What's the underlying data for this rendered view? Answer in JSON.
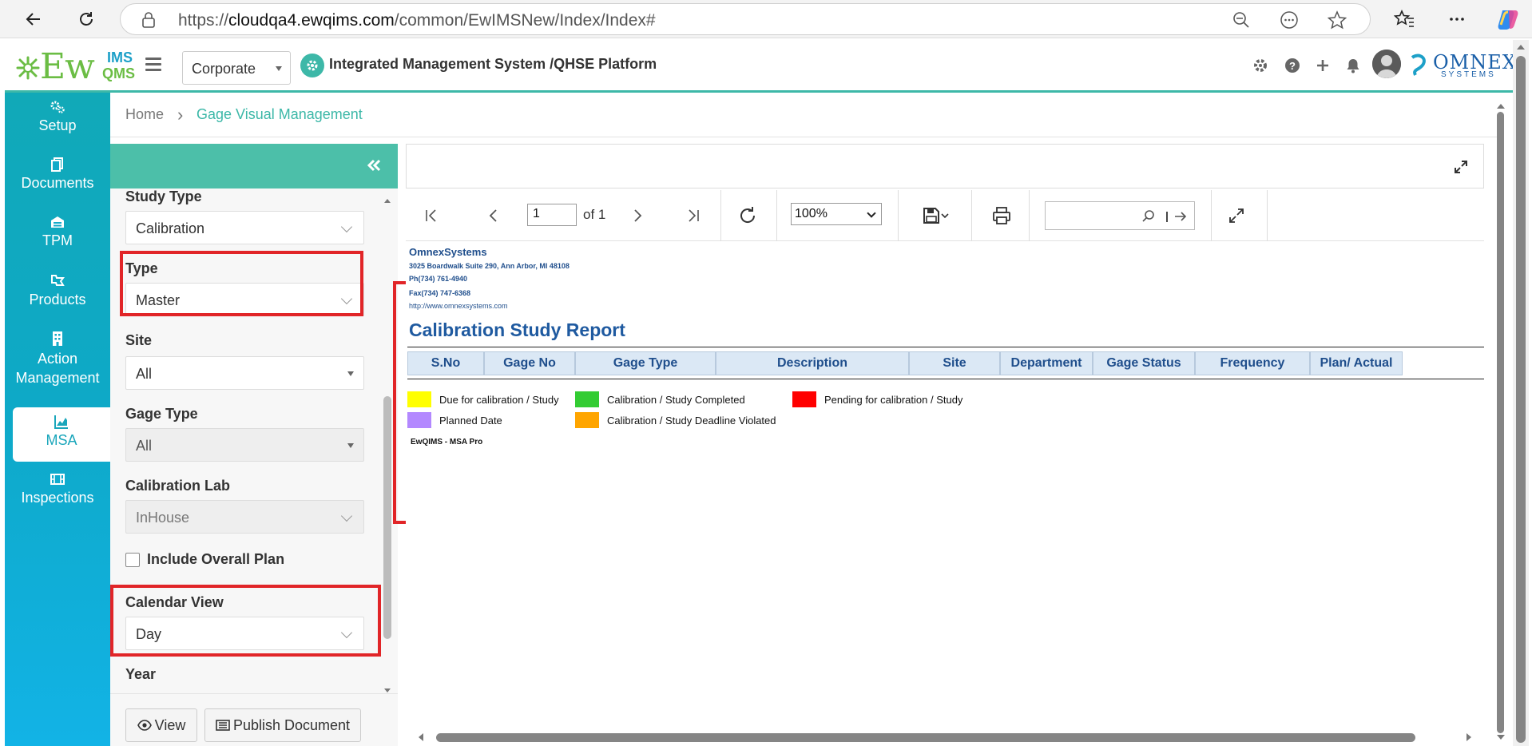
{
  "browser": {
    "url_prefix": "https://",
    "url_host": "cloudqa4.ewqims.com",
    "url_path": "/common/EwIMSNew/Index/Index#",
    "icons": [
      "back-arrow-icon",
      "refresh-icon",
      "lock-icon",
      "zoom-out-icon",
      "more-circle-icon",
      "favorite-star-icon",
      "favorites-list-icon",
      "ellipsis-icon",
      "copilot-icon"
    ]
  },
  "header": {
    "logo_ew": "Ew",
    "logo_ims": "IMS",
    "logo_qms": "QMS",
    "corporate_select": "Corporate",
    "platform_title": "Integrated Management System /QHSE Platform",
    "omnex_top": "OMNEX",
    "omnex_bottom": "SYSTEMS",
    "accent": "#3db8a8"
  },
  "sidebar": {
    "items": [
      {
        "label": "Setup",
        "icon": "gears-icon"
      },
      {
        "label": "Documents",
        "icon": "documents-icon"
      },
      {
        "label": "TPM",
        "icon": "tpm-icon"
      },
      {
        "label": "Products",
        "icon": "products-icon"
      },
      {
        "label": "Action Management",
        "icon": "building-icon"
      },
      {
        "label": "MSA",
        "icon": "chart-icon",
        "active": true
      },
      {
        "label": "Inspections",
        "icon": "film-icon"
      }
    ]
  },
  "breadcrumb": {
    "home": "Home",
    "separator": "›",
    "current": "Gage Visual Management"
  },
  "filters": {
    "study_type_label": "Study Type",
    "study_type_value": "Calibration",
    "type_label": "Type",
    "type_value": "Master",
    "site_label": "Site",
    "site_value": "All",
    "gage_type_label": "Gage Type",
    "gage_type_value": "All",
    "calibration_lab_label": "Calibration Lab",
    "calibration_lab_value": "InHouse",
    "include_overall_plan_label": "Include Overall Plan",
    "include_overall_plan_checked": false,
    "calendar_view_label": "Calendar View",
    "calendar_view_value": "Day",
    "year_label": "Year",
    "view_button": "View",
    "publish_button": "Publish Document"
  },
  "viewer": {
    "page_value": "1",
    "of_text": "of 1",
    "zoom": "100%"
  },
  "report": {
    "company": "OmnexSystems",
    "address": "3025 Boardwalk Suite 290, Ann Arbor, MI 48108",
    "phone": "Ph(734) 761-4940",
    "fax": "Fax(734) 747-6368",
    "website": "http://www.omnexsystems.com",
    "title": "Calibration Study Report",
    "columns": [
      "S.No",
      "Gage No",
      "Gage Type",
      "Description",
      "Site",
      "Department",
      "Gage Status",
      "Frequency",
      "Plan/ Actual"
    ],
    "legend": [
      {
        "label": "Due for calibration / Study",
        "color": "#ffff00"
      },
      {
        "label": "Calibration / Study Completed",
        "color": "#33cc33"
      },
      {
        "label": "Pending for calibration / Study",
        "color": "#ff0000"
      },
      {
        "label": "Planned Date",
        "color": "#b388ff"
      },
      {
        "label": "Calibration / Study Deadline Violated",
        "color": "#ffa500"
      }
    ],
    "footer": "EwQIMS - MSA Pro"
  }
}
